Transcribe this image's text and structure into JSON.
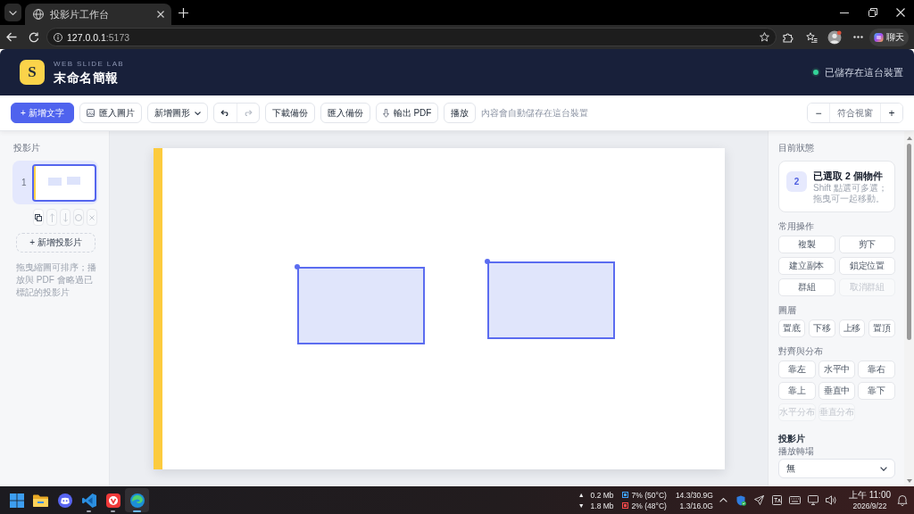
{
  "browser": {
    "tab": {
      "title": "投影片工作台"
    },
    "address": {
      "host": "127.0.0.1",
      "port": ":5173"
    },
    "chat_label": "聊天"
  },
  "header": {
    "logo": "S",
    "brand": "WEB SLIDE LAB",
    "title": "末命名簡報",
    "save_status": "已儲存在這台裝置"
  },
  "toolbar": {
    "items": [
      {
        "kind": "primary",
        "label": "+ 新增文字"
      },
      {
        "kind": "image",
        "label": "匯入圖片"
      },
      {
        "kind": "select",
        "label": "新增圖形"
      },
      {
        "kind": "history",
        "undo_disabled": false,
        "redo_disabled": true
      },
      {
        "kind": "plain",
        "label": "下載備份"
      },
      {
        "kind": "plain",
        "label": "匯入備份"
      },
      {
        "kind": "export",
        "label": "輸出 PDF"
      },
      {
        "kind": "plain",
        "label": "播放"
      }
    ],
    "hint": "內容會自動儲存在這台裝置",
    "zoom": {
      "out": "−",
      "label": "符合視窗",
      "in": "+"
    }
  },
  "slides_panel": {
    "title": "投影片",
    "slides": [
      {
        "number": "1",
        "selected": true
      }
    ],
    "actions": [
      {
        "kind": "duplicate",
        "disabled": false
      },
      {
        "kind": "up",
        "disabled": true
      },
      {
        "kind": "down",
        "disabled": true
      },
      {
        "kind": "hide",
        "disabled": true
      },
      {
        "kind": "delete",
        "disabled": true
      }
    ],
    "add_label": "+ 新增投影片",
    "help": "拖曳縮圖可排序；播放與 PDF 會略過已標記的投影片"
  },
  "canvas": {
    "slide": {
      "shapes": [
        {
          "kind": "rect",
          "selected": true
        },
        {
          "kind": "rect",
          "selected": true
        }
      ]
    }
  },
  "inspector": {
    "title": "目前狀態",
    "status": {
      "count": "2",
      "headline": "已選取 2 個物件",
      "hint": "Shift 點選可多選；拖曳可一起移動。"
    },
    "sections": [
      {
        "kind": "pairs",
        "title": "常用操作",
        "buttons": [
          {
            "label": "複製",
            "disabled": false
          },
          {
            "label": "剪下",
            "disabled": false
          },
          {
            "label": "建立副本",
            "disabled": false
          },
          {
            "label": "鎖定位置",
            "disabled": false
          },
          {
            "label": "群組",
            "disabled": false
          },
          {
            "label": "取消群組",
            "disabled": true
          }
        ]
      },
      {
        "kind": "row",
        "title": "圖層",
        "buttons": [
          {
            "label": "置底",
            "disabled": false
          },
          {
            "label": "下移",
            "disabled": false
          },
          {
            "label": "上移",
            "disabled": false
          },
          {
            "label": "置頂",
            "disabled": false
          }
        ]
      },
      {
        "kind": "triples",
        "title": "對齊與分布",
        "buttons": [
          {
            "label": "靠左",
            "disabled": false
          },
          {
            "label": "水平中",
            "disabled": false
          },
          {
            "label": "靠右",
            "disabled": false
          },
          {
            "label": "靠上",
            "disabled": false
          },
          {
            "label": "垂直中",
            "disabled": false
          },
          {
            "label": "靠下",
            "disabled": false
          },
          {
            "label": "水平分布",
            "disabled": true
          },
          {
            "label": "垂直分布",
            "disabled": true
          }
        ]
      }
    ],
    "slide": {
      "title": "投影片",
      "transition_label": "播放轉場",
      "transition_value": "無"
    }
  },
  "taskbar": {
    "apps": [
      {
        "kind": "start",
        "running": false,
        "selected": false
      },
      {
        "kind": "folder",
        "running": false,
        "selected": false
      },
      {
        "kind": "chat",
        "running": false,
        "selected": false
      },
      {
        "kind": "code",
        "running": true,
        "selected": false
      },
      {
        "kind": "tile",
        "running": true,
        "selected": false
      },
      {
        "kind": "swirl",
        "running": true,
        "selected": true
      }
    ],
    "net": [
      {
        "arrow": "▲",
        "value": "0.2 Mb"
      },
      {
        "arrow": "▼",
        "value": "1.8 Mb"
      }
    ],
    "cpu": "7% (50°C)",
    "gpu": "2% (48°C)",
    "ram": "14.3/30.9G",
    "vram": "1.3/16.0G",
    "time": "上午 11:00",
    "date": "2026/9/22"
  }
}
